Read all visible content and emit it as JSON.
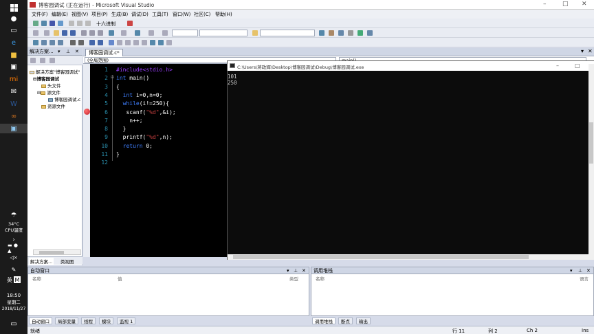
{
  "window": {
    "title": "博客园调试 (正在运行) - Microsoft Visual Studio"
  },
  "menu": [
    "文件(F)",
    "编辑(E)",
    "视图(V)",
    "项目(P)",
    "生成(B)",
    "调试(D)",
    "工具(T)",
    "窗口(W)",
    "社区(C)",
    "帮助(H)"
  ],
  "toolbar": {
    "hex_label": "十六进制"
  },
  "solution_explorer": {
    "title": "解决方案...",
    "items": [
      "解决方案\"博客园调试\"",
      "博客园调试",
      "头文件",
      "源文件",
      "博客园调试.c",
      "资源文件"
    ],
    "tab1": "解决方案...",
    "tab2": "类视图"
  },
  "editor": {
    "tab": "博客园调试.c*",
    "scope": "(全局范围)",
    "func": "main()",
    "line_numbers": [
      "1",
      "2",
      "3",
      "4",
      "5",
      "6",
      "7",
      "8",
      "9",
      "10",
      "11",
      "12"
    ],
    "lines": [
      [
        {
          "t": "#include<stdio.h>",
          "c": "pp"
        }
      ],
      [
        {
          "t": "int",
          "c": "kw"
        },
        {
          "t": " main()",
          "c": ""
        }
      ],
      [
        {
          "t": "{",
          "c": ""
        }
      ],
      [
        {
          "t": "  ",
          "c": ""
        },
        {
          "t": "int",
          "c": "kw"
        },
        {
          "t": " i=0,n=0;",
          "c": ""
        }
      ],
      [
        {
          "t": "  ",
          "c": ""
        },
        {
          "t": "while",
          "c": "kw"
        },
        {
          "t": "(i!=250){",
          "c": ""
        }
      ],
      [
        {
          "t": "   scanf(",
          "c": ""
        },
        {
          "t": "\"%d\"",
          "c": "st"
        },
        {
          "t": ",&i);",
          "c": ""
        }
      ],
      [
        {
          "t": "    n++;",
          "c": ""
        }
      ],
      [
        {
          "t": "  }",
          "c": ""
        }
      ],
      [
        {
          "t": "  printf(",
          "c": ""
        },
        {
          "t": "\"%d\"",
          "c": "st"
        },
        {
          "t": ",n);",
          "c": ""
        }
      ],
      [
        {
          "t": "  ",
          "c": ""
        },
        {
          "t": "return",
          "c": "kw"
        },
        {
          "t": " 0;",
          "c": ""
        }
      ],
      [
        {
          "t": "}",
          "c": ""
        }
      ],
      [
        {
          "t": "",
          "c": ""
        }
      ]
    ]
  },
  "console": {
    "title": "C:\\Users\\蒋政辉\\Desktop\\博客园调试\\Debug\\博客园调试.exe",
    "output": [
      "101",
      "250"
    ]
  },
  "autos": {
    "title": "自动窗口",
    "col_name": "名称",
    "col_value": "值",
    "col_type": "类型"
  },
  "callstack": {
    "title": "调用堆栈",
    "col_name": "名称",
    "col_lang": "语言"
  },
  "bottom_tabs_left": [
    "自动窗口",
    "局部变量",
    "线程",
    "模块",
    "监视 1"
  ],
  "bottom_tabs_right": [
    "调用堆栈",
    "断点",
    "输出"
  ],
  "status": {
    "ready": "就绪",
    "row": "行 11",
    "col": "列 2",
    "ch": "Ch 2",
    "ins": "Ins"
  },
  "taskbar": {
    "temp": "34°C",
    "cpu": "CPU温度",
    "lang": "英",
    "time": "18:50",
    "weekday": "星期二",
    "date": "2018/11/27"
  },
  "colors": {
    "keyword": "#3f7fff",
    "string": "#c84040",
    "preproc": "#9b3fff",
    "breakpoint": "#c0202a"
  }
}
